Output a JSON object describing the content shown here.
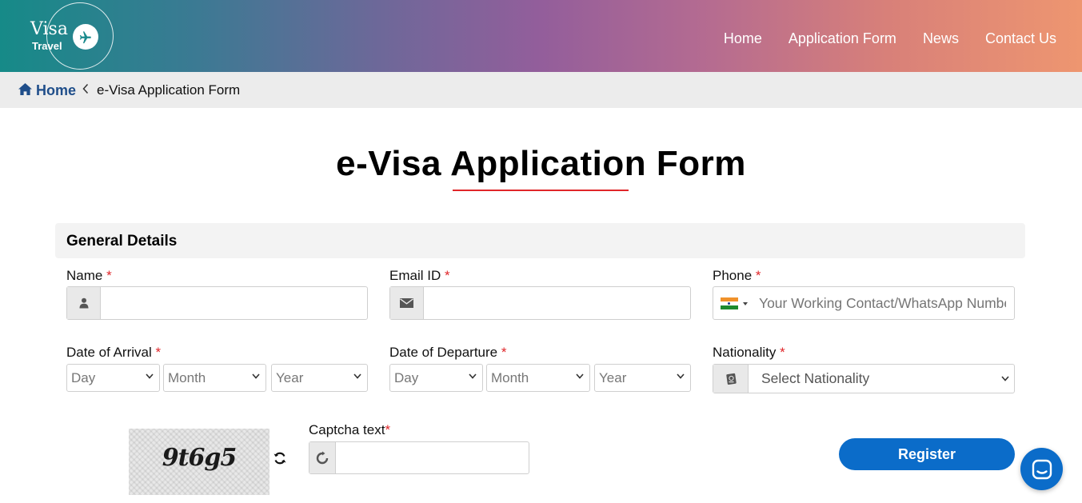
{
  "brand": {
    "line1": "Visa",
    "line2": "Travel"
  },
  "nav": {
    "items": [
      {
        "label": "Home"
      },
      {
        "label": "Application Form"
      },
      {
        "label": "News"
      },
      {
        "label": "Contact Us"
      }
    ]
  },
  "breadcrumb": {
    "home": "Home",
    "current": "e-Visa Application Form"
  },
  "page": {
    "title": "e-Visa Application Form"
  },
  "section": {
    "title": "General Details"
  },
  "form": {
    "name": {
      "label": "Name",
      "required_mark": "*",
      "value": ""
    },
    "email": {
      "label": "Email ID",
      "required_mark": "*",
      "value": ""
    },
    "phone": {
      "label": "Phone",
      "required_mark": "*",
      "placeholder": "Your Working Contact/WhatsApp Number"
    },
    "arrival": {
      "label": "Date of Arrival",
      "required_mark": "*",
      "day": "Day",
      "month": "Month",
      "year": "Year"
    },
    "departure": {
      "label": "Date of Departure",
      "required_mark": "*",
      "day": "Day",
      "month": "Month",
      "year": "Year"
    },
    "nationality": {
      "label": "Nationality",
      "required_mark": "*",
      "selected": "Select Nationality"
    },
    "captcha": {
      "label": "Captcha text",
      "required_mark": "*",
      "image_text": "9t6g5",
      "value": ""
    },
    "register_label": "Register"
  },
  "colors": {
    "accent": "#0b6cc9",
    "required": "#e0262a",
    "breadcrumb": "#1f4e8a",
    "header_start": "#168a88",
    "header_end": "#ee9670"
  },
  "icons": [
    "plane-icon",
    "home-icon",
    "chevron-left-icon",
    "user-icon",
    "envelope-icon",
    "india-flag-icon",
    "passport-icon",
    "refresh-icon",
    "chat-icon",
    "chevron-down-icon"
  ]
}
